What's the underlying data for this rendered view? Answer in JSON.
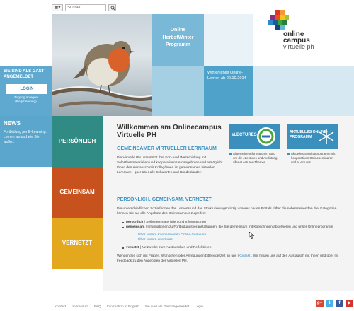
{
  "topbar": {
    "lang_icon": "flag-icon",
    "search_placeholder": "Suchen",
    "search_icon": "search-icon"
  },
  "hero": {
    "tile_title": "Online\nHerbstWinter\nProgramm",
    "tile_note": "Winterliches Online-Lernen ab 20.10.2014"
  },
  "logo": {
    "line1": "online",
    "line2": "campus",
    "line3": "virtuelle ph"
  },
  "guest": {
    "title": "SIE SIND ALS GAST ANGEMELDET",
    "login_label": "LOGIN",
    "sub": "Zugang anlegen (Registrierung)"
  },
  "news": {
    "title": "NEWS",
    "text": "Fortbildung per E-Learning: Lernen wo und wie Sie wollen."
  },
  "categories": [
    {
      "label": "PERSÖNLICH",
      "color": "#2f8b83"
    },
    {
      "label": "GEMEINSAM",
      "color": "#c7521d"
    },
    {
      "label": "VERNETZT",
      "color": "#e3a81e"
    }
  ],
  "main": {
    "title": "Willkommen am Onlinecampus Virtuelle PH",
    "section1_title": "GEMEINSAMER VIRTUELLER LERNRAUM",
    "section1_text": "Die Virtuelle PH unterstützt Ihre Fort- und Weiterbildung mit Selbstlernmaterialien und kooperativen Lernangeboten und ermöglicht Ihnen den Austausch mit Kolleg/innen im gemeinsamen virtuellen Lernraum - quer über alle Schularten und Bundesländer.",
    "section2_title": "PERSÖNLICH, GEMEINSAM, VERNETZT",
    "section2_text": "Die unterschiedlichen Sozialformen des Lernens und das Strukturierungsprinzip unseres neuen Portals. Über die nebenstehenden drei Kategorien können Sie auf alle Angebote des Onlinecampus zugreifen:",
    "bullets": [
      {
        "term": "persönlich",
        "text": " | Selbstlernmaterialien und Informationen"
      },
      {
        "term": "gemeinsam",
        "text": " | Informationen zu Fortbildungsveranstaltungen, die Sie gemeinsam mit Kolleg/innen absolvieren und unser Onlineprogramm"
      }
    ],
    "sublinks": [
      "Über unsere Kooperationen Online-Seminare",
      "Über unsere eLectures"
    ],
    "bullet3_term": "vernetzt",
    "bullet3_text": " | Netzwerke zum Austauschen und Reflektieren",
    "closing_a": "Wenden Sie sich mit Fragen, Wünschen oder Anregungen bitte jederzeit an uns (",
    "closing_link": "Kontakt",
    "closing_b": "). Wir freuen uns auf den Austausch mit Ihnen und über Ihr Feedback zu den Angeboten der Virtuellen PH."
  },
  "cards": [
    {
      "title": "eLECTURES",
      "caption": "Allgemeine Informationen rund um die eLectures und Auflistung aller eLectures-Themen"
    },
    {
      "title": "AKTUELLES ONLINE-PROGRAMM",
      "caption": "Aktuelles Seminarprogramm mit kooperativen Onlineseminaren und eLectures"
    }
  ],
  "footer": {
    "links": [
      "Kontakt",
      "Impressum",
      "FAQ",
      "Information in English",
      "Sie sind als Gast angemeldet",
      "Login"
    ]
  },
  "social": [
    {
      "icon": "google-plus-icon",
      "label": "g+",
      "color": "#d34836"
    },
    {
      "icon": "twitter-icon",
      "label": "t",
      "color": "#4ab0e6"
    },
    {
      "icon": "facebook-icon",
      "label": "f",
      "color": "#3b5998"
    },
    {
      "icon": "youtube-icon",
      "label": "▶",
      "color": "#d9322a"
    }
  ]
}
